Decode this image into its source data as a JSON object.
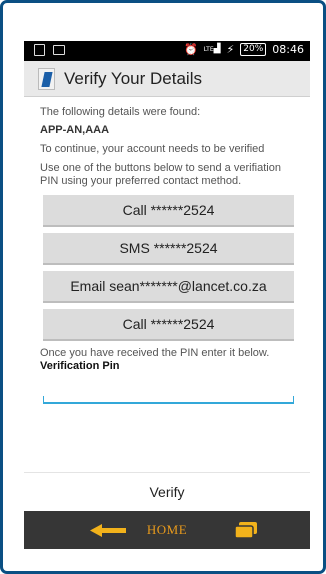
{
  "status_bar": {
    "network": "LTE",
    "battery": "20%",
    "time": "08:46"
  },
  "header": {
    "title": "Verify Your Details",
    "app_icon": "app-logo-icon"
  },
  "details": {
    "found_text": "The following details were found:",
    "account_name": "APP-AN,AAA",
    "continue_text": "To continue, your account needs to be verified",
    "instruction_text": "Use one of the buttons below to send a verifiation PIN using your preferred contact method."
  },
  "contact_buttons": [
    {
      "label": "Call ******2524"
    },
    {
      "label": "SMS ******2524"
    },
    {
      "label": "Email sean*******@lancet.co.za"
    },
    {
      "label": "Call ******2524"
    }
  ],
  "pin": {
    "prompt": "Once you have received the PIN enter it below.",
    "label": "Verification Pin",
    "value": ""
  },
  "actions": {
    "verify_label": "Verify"
  },
  "nav": {
    "home_label": "HOME",
    "accent_color": "#e89a1c"
  }
}
